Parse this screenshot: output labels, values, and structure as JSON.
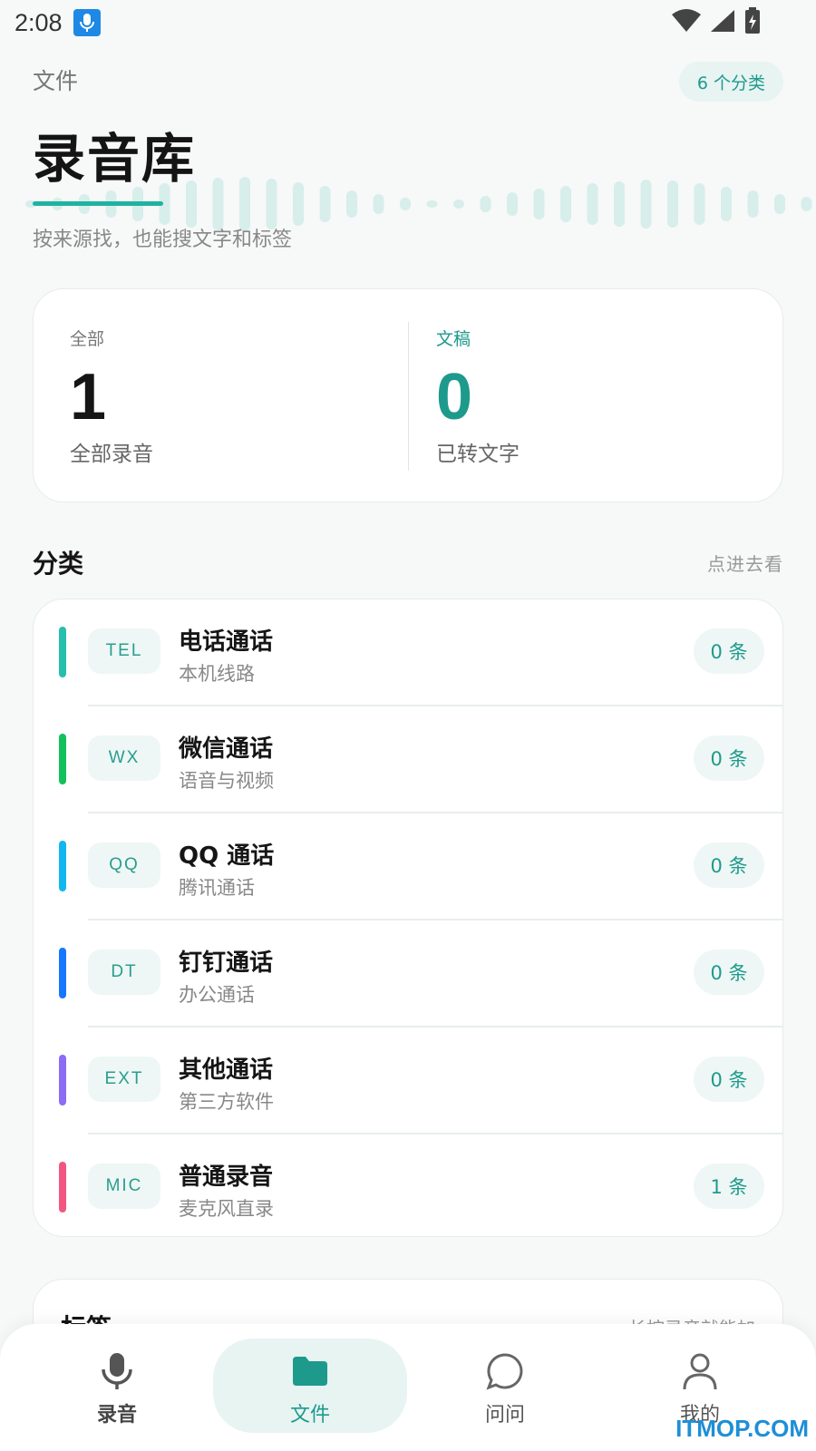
{
  "status_bar": {
    "time": "2:08",
    "app_icon": "microphone-icon"
  },
  "header": {
    "breadcrumb": "文件",
    "category_count": "6 个分类",
    "title": "录音库",
    "subtitle": "按来源找，也能搜文字和标签"
  },
  "summary": {
    "all": {
      "label": "全部",
      "value": "1",
      "desc": "全部录音"
    },
    "transcripts": {
      "label": "文稿",
      "value": "0",
      "desc": "已转文字"
    }
  },
  "categories_section": {
    "title": "分类",
    "hint": "点进去看",
    "items": [
      {
        "code": "TEL",
        "name": "电话通话",
        "sub": "本机线路",
        "count": "0 条",
        "color": "#26bfae"
      },
      {
        "code": "WX",
        "name": "微信通话",
        "sub": "语音与视频",
        "count": "0 条",
        "color": "#12c15c"
      },
      {
        "code": "QQ",
        "name": "QQ 通话",
        "sub": "腾讯通话",
        "count": "0 条",
        "color": "#13b7f0"
      },
      {
        "code": "DT",
        "name": "钉钉通话",
        "sub": "办公通话",
        "count": "0 条",
        "color": "#1677ff"
      },
      {
        "code": "EXT",
        "name": "其他通话",
        "sub": "第三方软件",
        "count": "0 条",
        "color": "#8b6cf5"
      },
      {
        "code": "MIC",
        "name": "普通录音",
        "sub": "麦克风直录",
        "count": "1 条",
        "color": "#f25680"
      }
    ]
  },
  "tags_section": {
    "title": "标签",
    "hint": "长按录音就能加"
  },
  "bottom_nav": [
    {
      "label": "录音",
      "icon": "microphone-icon"
    },
    {
      "label": "文件",
      "icon": "folder-icon",
      "active": true
    },
    {
      "label": "问问",
      "icon": "chat-bubble-icon"
    },
    {
      "label": "我的",
      "icon": "person-icon"
    }
  ],
  "watermark": "ITMOP.COM",
  "colors": {
    "accent": "#1e9a8c",
    "accent_bg": "#e7f4f2"
  }
}
